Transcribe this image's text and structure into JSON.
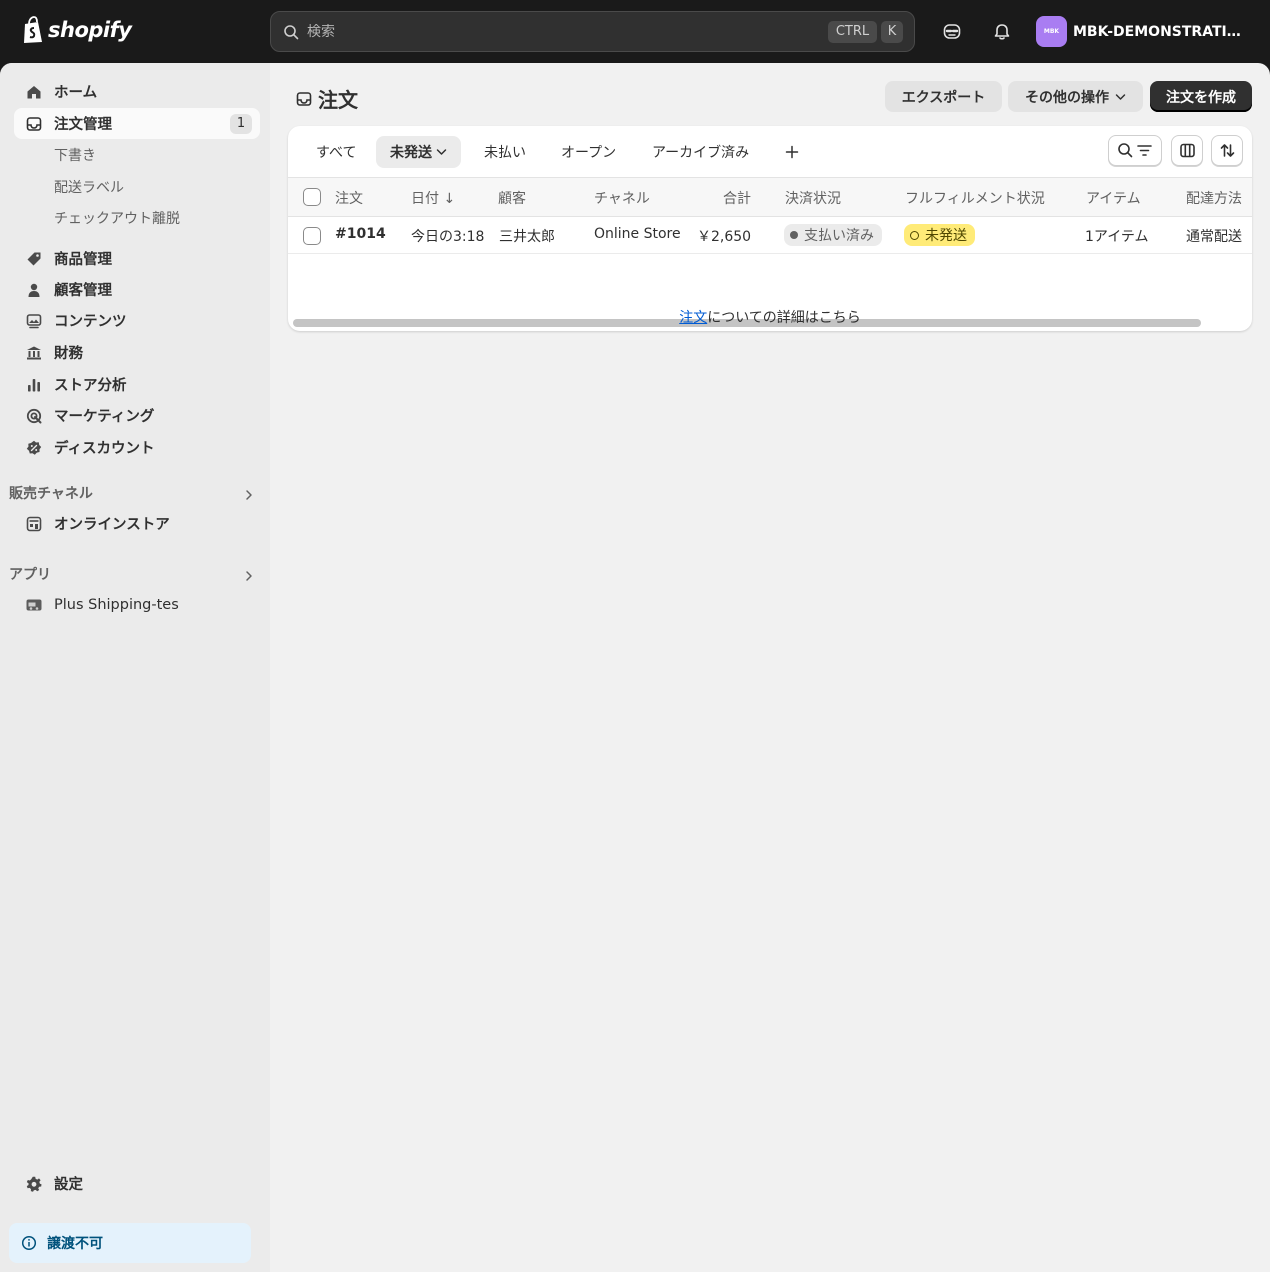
{
  "topbar": {
    "brand": "shopify",
    "search_placeholder": "検索",
    "kbd_ctrl": "CTRL",
    "kbd_k": "K",
    "store_avatar": "MBK",
    "store_name": "MBK-DEMONSTRATIO..."
  },
  "sidebar": {
    "items": [
      {
        "label": "ホーム",
        "icon": "home-icon"
      },
      {
        "label": "注文管理",
        "icon": "inbox-icon",
        "badge": "1"
      },
      {
        "label": "商品管理",
        "icon": "tag-icon"
      },
      {
        "label": "顧客管理",
        "icon": "person-icon"
      },
      {
        "label": "コンテンツ",
        "icon": "image-icon"
      },
      {
        "label": "財務",
        "icon": "bank-icon"
      },
      {
        "label": "ストア分析",
        "icon": "bar-chart-icon"
      },
      {
        "label": "マーケティング",
        "icon": "target-icon"
      },
      {
        "label": "ディスカウント",
        "icon": "discount-icon"
      }
    ],
    "order_subitems": [
      "下書き",
      "配送ラベル",
      "チェックアウト離脱"
    ],
    "sales_channels_heading": "販売チャネル",
    "online_store": "オンラインストア",
    "apps_heading": "アプリ",
    "app_item": "Plus Shipping-tes",
    "settings": "設定",
    "notice": "譲渡不可"
  },
  "header": {
    "title": "注文",
    "export": "エクスポート",
    "more_actions": "その他の操作",
    "create_order": "注文を作成"
  },
  "tabs": [
    "すべて",
    "未発送",
    "未払い",
    "オープン",
    "アーカイブ済み"
  ],
  "active_tab_index": 1,
  "table": {
    "headers": [
      "注文",
      "日付 ↓",
      "顧客",
      "チャネル",
      "合計",
      "決済状況",
      "フルフィルメント状況",
      "アイテム",
      "配達方法"
    ],
    "rows": [
      {
        "order": "#1014",
        "date": "今日の3:18",
        "customer": "三井太郎",
        "channel": "Online Store",
        "total": "￥2,650",
        "payment": "支払い済み",
        "fulfillment": "未発送",
        "items": "1アイテム",
        "delivery": "通常配送"
      }
    ]
  },
  "learn_more": {
    "link": "注文",
    "text": "についての詳細はこちら"
  },
  "colors": {
    "topbar_bg": "#1a1a1a",
    "sidebar_bg": "#ebebeb",
    "primary_button": "#303030",
    "unfulfilled_badge": "#ffeb78",
    "link": "#005bd3",
    "notice_bg": "#e4f2fc"
  }
}
